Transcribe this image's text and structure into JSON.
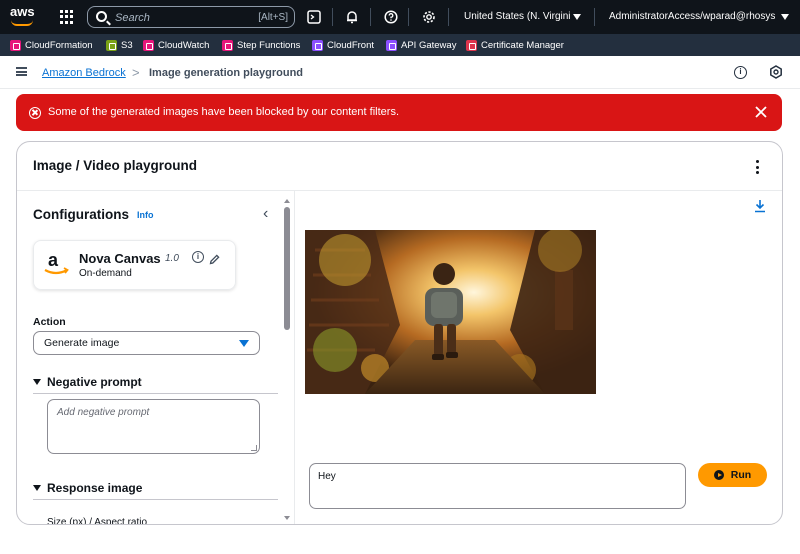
{
  "topnav": {
    "logo_text": "aws",
    "search_placeholder": "Search",
    "search_shortcut": "[Alt+S]",
    "region": "United States (N. Virgini",
    "account": "AdministratorAccess/wparad@rhosys.c"
  },
  "favorites": [
    {
      "label": "CloudFormation",
      "color": "#e7157b"
    },
    {
      "label": "S3",
      "color": "#7aa116"
    },
    {
      "label": "CloudWatch",
      "color": "#e7157b"
    },
    {
      "label": "Step Functions",
      "color": "#e7157b"
    },
    {
      "label": "CloudFront",
      "color": "#8c4fff"
    },
    {
      "label": "API Gateway",
      "color": "#8c4fff"
    },
    {
      "label": "Certificate Manager",
      "color": "#dd344c"
    }
  ],
  "breadcrumb": {
    "parent": "Amazon Bedrock",
    "separator": ">",
    "current": "Image generation playground"
  },
  "flash": {
    "message": "Some of the generated images have been blocked by our content filters.",
    "color": "#d91515"
  },
  "container": {
    "title": "Image / Video playground"
  },
  "config": {
    "title": "Configurations",
    "info": "Info",
    "model_name": "Nova Canvas",
    "model_version": "1.0",
    "model_mode": "On-demand",
    "action_label": "Action",
    "action_value": "Generate image",
    "negative_prompt_title": "Negative prompt",
    "negative_prompt_placeholder": "Add negative prompt",
    "response_image_title": "Response image",
    "size_label": "Size (px) / Aspect ratio"
  },
  "playground": {
    "prompt_value": "Hey",
    "run_label": "Run",
    "accent_color": "#ff9900"
  }
}
